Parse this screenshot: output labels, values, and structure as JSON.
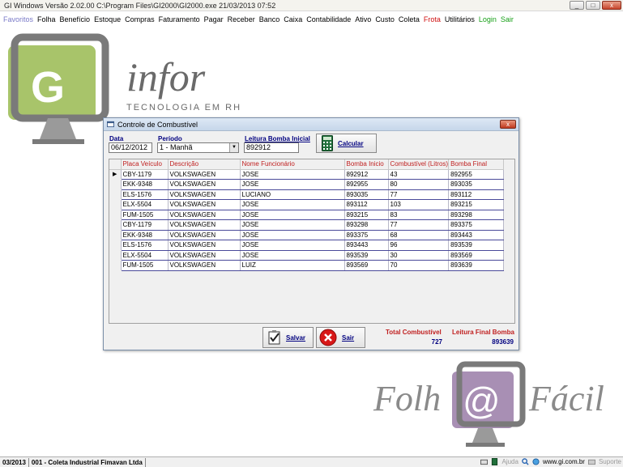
{
  "window": {
    "title": "GI Windows  Versão  2.02.00      C:\\Program Files\\GI2000\\GI2000.exe   21/03/2013 07:52",
    "controls": [
      "_",
      "□",
      "x"
    ]
  },
  "menu": {
    "favorites": "Favoritos",
    "items": [
      {
        "label": "Folha",
        "color": "normal"
      },
      {
        "label": "Benefício",
        "color": "normal"
      },
      {
        "label": "Estoque",
        "color": "normal"
      },
      {
        "label": "Compras",
        "color": "normal"
      },
      {
        "label": "Faturamento",
        "color": "normal"
      },
      {
        "label": "Pagar",
        "color": "normal"
      },
      {
        "label": "Receber",
        "color": "normal"
      },
      {
        "label": "Banco",
        "color": "normal"
      },
      {
        "label": "Caixa",
        "color": "normal"
      },
      {
        "label": "Contabilidade",
        "color": "normal"
      },
      {
        "label": "Ativo",
        "color": "normal"
      },
      {
        "label": "Custo",
        "color": "normal"
      },
      {
        "label": "Coleta",
        "color": "normal"
      },
      {
        "label": "Frota",
        "color": "red"
      },
      {
        "label": "Utilitários",
        "color": "normal"
      },
      {
        "label": "Login",
        "color": "green"
      },
      {
        "label": "Sair",
        "color": "green"
      }
    ]
  },
  "logos": {
    "ginfor_letters": "G",
    "ginfor_name": "infor",
    "ginfor_tagline": "TECNOLOGIA EM RH",
    "folha_left": "Folh",
    "folha_at": "@",
    "folha_right": "Fácil",
    "colors": {
      "green": "#a8c46a",
      "purple": "#a88fb4",
      "gray": "#8a8a8a"
    }
  },
  "dialog": {
    "title": "Controle de Combustível",
    "data_label": "Data",
    "data_value": "06/12/2012",
    "periodo_label": "Período",
    "periodo_value": "1 - Manhã",
    "leitura_label": "Leitura Bomba Inicial",
    "leitura_value": "892912",
    "calc_label": "Calcular",
    "columns": [
      "Placa Veículo",
      "Descrição",
      "Nome Funcionário",
      "Bomba Inicio",
      "Combustível (Litros)",
      "Bomba Final"
    ],
    "rows": [
      [
        "CBY-1179",
        "VOLKSWAGEN",
        "JOSE",
        "892912",
        "43",
        "892955"
      ],
      [
        "EKK-9348",
        "VOLKSWAGEN",
        "JOSE",
        "892955",
        "80",
        "893035"
      ],
      [
        "ELS-1576",
        "VOLKSWAGEN",
        "LUCIANO",
        "893035",
        "77",
        "893112"
      ],
      [
        "ELX-5504",
        "VOLKSWAGEN",
        "JOSE",
        "893112",
        "103",
        "893215"
      ],
      [
        "FUM-1505",
        "VOLKSWAGEN",
        "JOSE",
        "893215",
        "83",
        "893298"
      ],
      [
        "CBY-1179",
        "VOLKSWAGEN",
        "JOSE",
        "893298",
        "77",
        "893375"
      ],
      [
        "EKK-9348",
        "VOLKSWAGEN",
        "JOSE",
        "893375",
        "68",
        "893443"
      ],
      [
        "ELS-1576",
        "VOLKSWAGEN",
        "JOSE",
        "893443",
        "96",
        "893539"
      ],
      [
        "ELX-5504",
        "VOLKSWAGEN",
        "JOSE",
        "893539",
        "30",
        "893569"
      ],
      [
        "FUM-1505",
        "VOLKSWAGEN",
        "LUIZ",
        "893569",
        "70",
        "893639"
      ]
    ],
    "current_row_marker": "▶",
    "save_label": "Salvar",
    "exit_label": "Sair",
    "total_label": "Total Combustível",
    "total_value": "727",
    "final_label": "Leitura Final Bomba",
    "final_value": "893639"
  },
  "status": {
    "period": "03/2013",
    "company": "001 - Coleta Industrial Fimavan Ltda",
    "help": "Ajuda",
    "website": "www.gi.com.br",
    "support": "Suporte"
  }
}
